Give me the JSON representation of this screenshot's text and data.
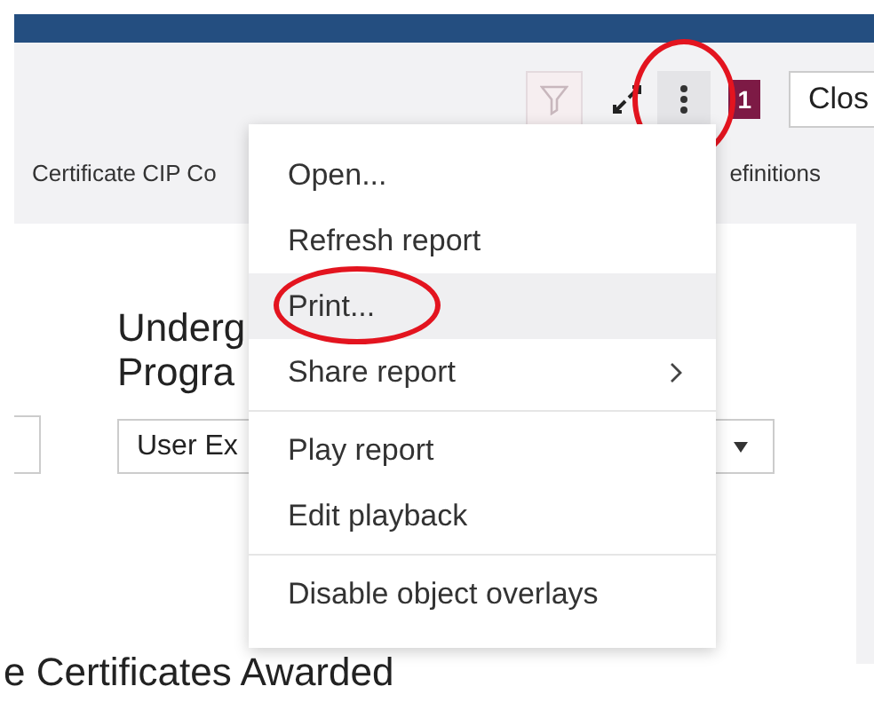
{
  "toolbar": {
    "filter_disabled": true,
    "more_circled": true,
    "badge": "1",
    "close_button": "Clos"
  },
  "tabs": [
    {
      "label": "Certificate CIP Co",
      "selected": false
    },
    {
      "label": "efinitions",
      "selected": false
    }
  ],
  "content": {
    "heading_lines": [
      "Underg",
      "Progra"
    ],
    "dropdown_value": "User Ex",
    "section_title": "e Certificates Awarded"
  },
  "menu": {
    "items": [
      {
        "kind": "item",
        "label": "Open...",
        "highlighted": false,
        "circled": false
      },
      {
        "kind": "item",
        "label": "Refresh report",
        "highlighted": false,
        "circled": false
      },
      {
        "kind": "item",
        "label": "Print...",
        "highlighted": true,
        "circled": true
      },
      {
        "kind": "submenu",
        "label": "Share report",
        "highlighted": false,
        "circled": false
      },
      {
        "kind": "separator"
      },
      {
        "kind": "item",
        "label": "Play report",
        "highlighted": false,
        "circled": false
      },
      {
        "kind": "item",
        "label": "Edit playback",
        "highlighted": false,
        "circled": false
      },
      {
        "kind": "separator"
      },
      {
        "kind": "item",
        "label": "Disable object overlays",
        "highlighted": false,
        "circled": false
      }
    ]
  }
}
